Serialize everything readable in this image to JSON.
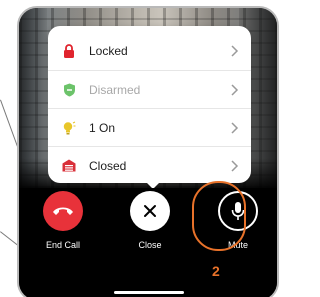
{
  "menu": {
    "items": [
      {
        "label": "Locked",
        "icon": "lock-icon",
        "color": "#e0242e",
        "muted": false
      },
      {
        "label": "Disarmed",
        "icon": "shield-icon",
        "color": "#6cc36a",
        "muted": true
      },
      {
        "label": "1 On",
        "icon": "lightbulb-icon",
        "color": "#e8c62a",
        "muted": false
      },
      {
        "label": "Closed",
        "icon": "garage-icon",
        "color": "#d9303a",
        "muted": false
      }
    ]
  },
  "controls": {
    "end_call": {
      "label": "End Call",
      "icon": "phone-hangup-icon",
      "color": "#e8323a"
    },
    "close": {
      "label": "Close",
      "icon": "close-icon",
      "color": "#ffffff"
    },
    "mute": {
      "label": "Mute",
      "icon": "microphone-icon",
      "color": "#000000"
    }
  },
  "annotation": {
    "badge": "2",
    "color": "#e8722a"
  }
}
